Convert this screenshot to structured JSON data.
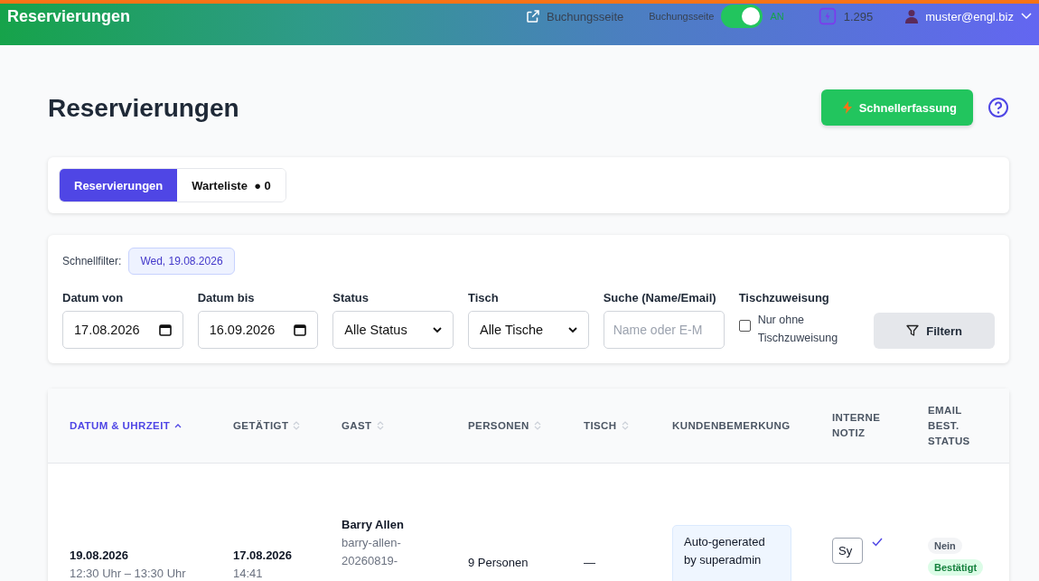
{
  "topbar": {
    "brand": "Reservierungen",
    "booking_link": "Buchungsseite",
    "toggle": {
      "label": "Buchungsseite",
      "on": true,
      "state_text": "AN"
    },
    "credits": "1.295",
    "user": "muster@engl.biz"
  },
  "page": {
    "title": "Reservierungen",
    "quick_button": "Schnellerfassung"
  },
  "tabs": [
    {
      "label": "Reservierungen",
      "selected": true
    },
    {
      "label": "Warteliste",
      "count": "● 0",
      "selected": false
    }
  ],
  "filters": {
    "quick_label": "Schnellfilter:",
    "quick_chip": "Wed, 19.08.2026",
    "fields": [
      {
        "kind": "date",
        "label": "Datum von",
        "value": "17.08.2026"
      },
      {
        "kind": "date",
        "label": "Datum bis",
        "value": "16.09.2026"
      },
      {
        "kind": "select",
        "label": "Status",
        "value": "Alle Status"
      },
      {
        "kind": "select",
        "label": "Tisch",
        "value": "Alle Tische"
      },
      {
        "kind": "text",
        "label": "Suche (Name/Email)",
        "placeholder": "Name oder E-M"
      },
      {
        "kind": "checkbox",
        "label": "Tischzuweisung",
        "option": "Nur ohne Tischzuweisung",
        "checked": false
      }
    ],
    "button": "Filtern"
  },
  "table": {
    "columns": [
      {
        "label": "DATUM & UHRZEIT",
        "sortable": true,
        "selected": true
      },
      {
        "label": "GETÄTIGT",
        "sortable": true,
        "selected": false
      },
      {
        "label": "GAST",
        "sortable": true,
        "selected": false
      },
      {
        "label": "PERSONEN",
        "sortable": true,
        "selected": false
      },
      {
        "label": "TISCH",
        "sortable": true,
        "selected": false
      },
      {
        "label": "KUNDENBEMERKUNG",
        "sortable": false,
        "selected": false
      },
      {
        "label": "INTERNE NOTIZ",
        "sortable": false,
        "selected": false
      },
      {
        "label": "EMAIL BEST. STATUS",
        "sortable": false,
        "selected": false
      }
    ],
    "rows": [
      {
        "date": "19.08.2026",
        "time": "12:30 Uhr – 13:30 Uhr",
        "booked_date": "17.08.2026",
        "booked_time": "14:41",
        "guest": "Barry Allen",
        "guest_lines": [
          "barry-allen-",
          "20260819-"
        ],
        "persons": "9 Personen",
        "table": "—",
        "remark": [
          "Auto-generated",
          "by superadmin"
        ],
        "note": "Sy",
        "note_saved": true,
        "email": "Nein",
        "status": "Bestätigt"
      }
    ]
  }
}
